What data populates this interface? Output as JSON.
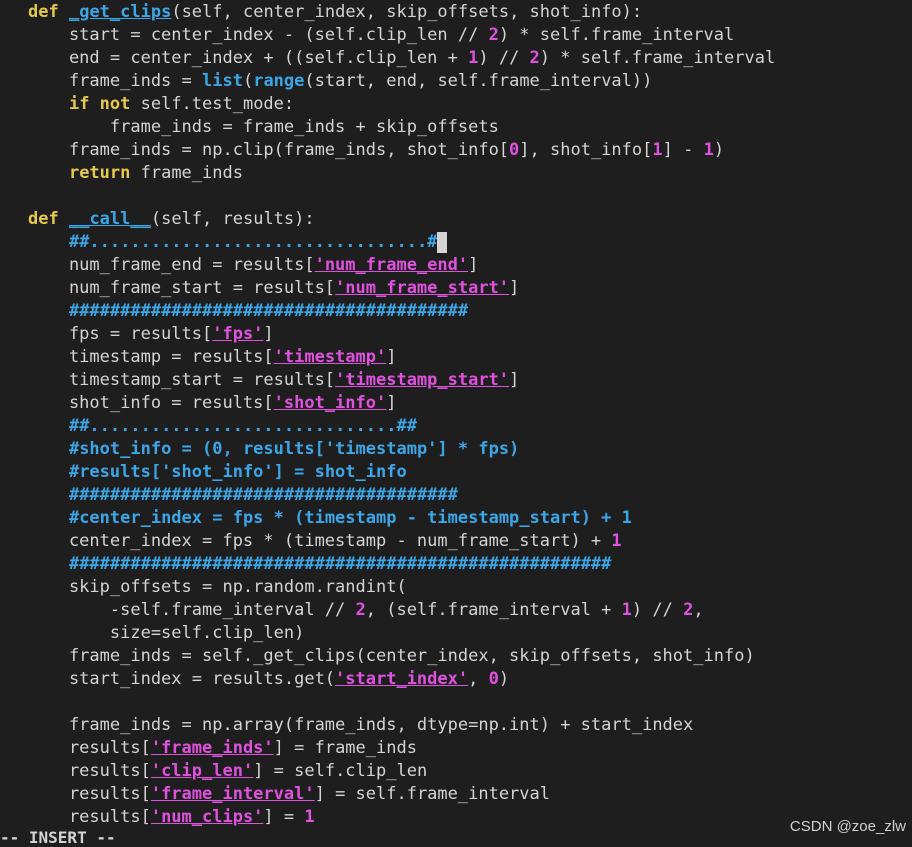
{
  "colors": {
    "background": "#1e1e1e",
    "text": "#d4d4d4",
    "keyword": "#e6c84a",
    "function": "#3aa7e8",
    "number": "#e051e0",
    "string": "#e051e0",
    "comment": "#3aa7e8"
  },
  "lines": [
    [
      [
        "kw",
        "def"
      ],
      [
        "p",
        " "
      ],
      [
        "fn",
        "_get_clips"
      ],
      [
        "p",
        "(self, center_index, skip_offsets, shot_info):"
      ]
    ],
    [
      [
        "p",
        "    start = center_index - (self.clip_len // "
      ],
      [
        "num",
        "2"
      ],
      [
        "p",
        ") * self.frame_interval"
      ]
    ],
    [
      [
        "p",
        "    end = center_index + ((self.clip_len + "
      ],
      [
        "num",
        "1"
      ],
      [
        "p",
        ") // "
      ],
      [
        "num",
        "2"
      ],
      [
        "p",
        ") * self.frame_interval"
      ]
    ],
    [
      [
        "p",
        "    frame_inds = "
      ],
      [
        "bi",
        "list"
      ],
      [
        "p",
        "("
      ],
      [
        "bi",
        "range"
      ],
      [
        "p",
        "(start, end, self.frame_interval))"
      ]
    ],
    [
      [
        "p",
        "    "
      ],
      [
        "kw",
        "if not"
      ],
      [
        "p",
        " self.test_mode:"
      ]
    ],
    [
      [
        "p",
        "        frame_inds = frame_inds + skip_offsets"
      ]
    ],
    [
      [
        "p",
        "    frame_inds = np.clip(frame_inds, shot_info["
      ],
      [
        "num",
        "0"
      ],
      [
        "p",
        "], shot_info["
      ],
      [
        "num",
        "1"
      ],
      [
        "p",
        "] - "
      ],
      [
        "num",
        "1"
      ],
      [
        "p",
        ")"
      ]
    ],
    [
      [
        "p",
        "    "
      ],
      [
        "kw",
        "return"
      ],
      [
        "p",
        " frame_inds"
      ]
    ],
    [],
    [
      [
        "kw",
        "def"
      ],
      [
        "p",
        " "
      ],
      [
        "fn",
        "__call__"
      ],
      [
        "p",
        "(self, results):"
      ]
    ],
    [
      [
        "p",
        "    "
      ],
      [
        "cm",
        "##.................................#"
      ],
      [
        "cursor",
        ""
      ]
    ],
    [
      [
        "p",
        "    num_frame_end = results["
      ],
      [
        "str",
        "'num_frame_end'"
      ],
      [
        "p",
        "]"
      ]
    ],
    [
      [
        "p",
        "    num_frame_start = results["
      ],
      [
        "str",
        "'num_frame_start'"
      ],
      [
        "p",
        "]"
      ]
    ],
    [
      [
        "p",
        "    "
      ],
      [
        "cm",
        "#######################################"
      ]
    ],
    [
      [
        "p",
        "    fps = results["
      ],
      [
        "str",
        "'fps'"
      ],
      [
        "p",
        "]"
      ]
    ],
    [
      [
        "p",
        "    timestamp = results["
      ],
      [
        "str",
        "'timestamp'"
      ],
      [
        "p",
        "]"
      ]
    ],
    [
      [
        "p",
        "    timestamp_start = results["
      ],
      [
        "str",
        "'timestamp_start'"
      ],
      [
        "p",
        "]"
      ]
    ],
    [
      [
        "p",
        "    shot_info = results["
      ],
      [
        "str",
        "'shot_info'"
      ],
      [
        "p",
        "]"
      ]
    ],
    [
      [
        "p",
        "    "
      ],
      [
        "cm",
        "##..............................##"
      ]
    ],
    [
      [
        "p",
        "    "
      ],
      [
        "cm",
        "#shot_info = (0, results['timestamp'] * fps)"
      ]
    ],
    [
      [
        "p",
        "    "
      ],
      [
        "cm",
        "#results['shot_info'] = shot_info"
      ]
    ],
    [
      [
        "p",
        "    "
      ],
      [
        "cm",
        "######################################"
      ]
    ],
    [
      [
        "p",
        "    "
      ],
      [
        "cm",
        "#center_index = fps * (timestamp - timestamp_start) + 1"
      ]
    ],
    [
      [
        "p",
        "    center_index = fps * (timestamp - num_frame_start) + "
      ],
      [
        "num",
        "1"
      ]
    ],
    [
      [
        "p",
        "    "
      ],
      [
        "cm",
        "#####################################################"
      ]
    ],
    [
      [
        "p",
        "    skip_offsets = np.random.randint("
      ]
    ],
    [
      [
        "p",
        "        -self.frame_interval // "
      ],
      [
        "num",
        "2"
      ],
      [
        "p",
        ", (self.frame_interval + "
      ],
      [
        "num",
        "1"
      ],
      [
        "p",
        ") // "
      ],
      [
        "num",
        "2"
      ],
      [
        "p",
        ","
      ]
    ],
    [
      [
        "p",
        "        size=self.clip_len)"
      ]
    ],
    [
      [
        "p",
        "    frame_inds = self._get_clips(center_index, skip_offsets, shot_info)"
      ]
    ],
    [
      [
        "p",
        "    start_index = results.get("
      ],
      [
        "str",
        "'start_index'"
      ],
      [
        "p",
        ", "
      ],
      [
        "num",
        "0"
      ],
      [
        "p",
        ")"
      ]
    ],
    [],
    [
      [
        "p",
        "    frame_inds = np.array(frame_inds, dtype=np.int) + start_index"
      ]
    ],
    [
      [
        "p",
        "    results["
      ],
      [
        "str",
        "'frame_inds'"
      ],
      [
        "p",
        "] = frame_inds"
      ]
    ],
    [
      [
        "p",
        "    results["
      ],
      [
        "str",
        "'clip_len'"
      ],
      [
        "p",
        "] = self.clip_len"
      ]
    ],
    [
      [
        "p",
        "    results["
      ],
      [
        "str",
        "'frame_interval'"
      ],
      [
        "p",
        "] = self.frame_interval"
      ]
    ],
    [
      [
        "p",
        "    results["
      ],
      [
        "str",
        "'num_clips'"
      ],
      [
        "p",
        "] = "
      ],
      [
        "num",
        "1"
      ]
    ]
  ],
  "status_line": "-- INSERT --",
  "watermark": "CSDN @zoe_zlw"
}
